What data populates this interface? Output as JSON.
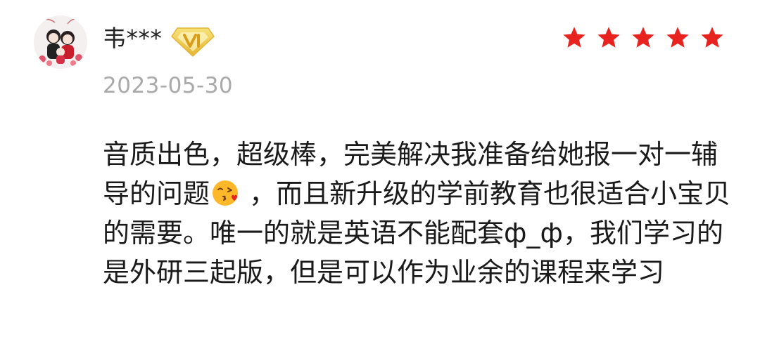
{
  "review": {
    "username": "韦***",
    "date": "2023-05-30",
    "rating": 5,
    "star_color": "#e8221e",
    "badge_icon": "vip-diamond-badge",
    "text_part1": "音质出色，超级棒，完美解决我准备给她报一对一辅导的问题",
    "emoji": "kissing-face-with-heart",
    "text_part2": " ，而且新升级的学前教育也很适合小宝贝的需要。唯一的就是英语不能配套ф_ф，我们学习的是外研三起版，但是可以作为业余的课程来学习"
  }
}
